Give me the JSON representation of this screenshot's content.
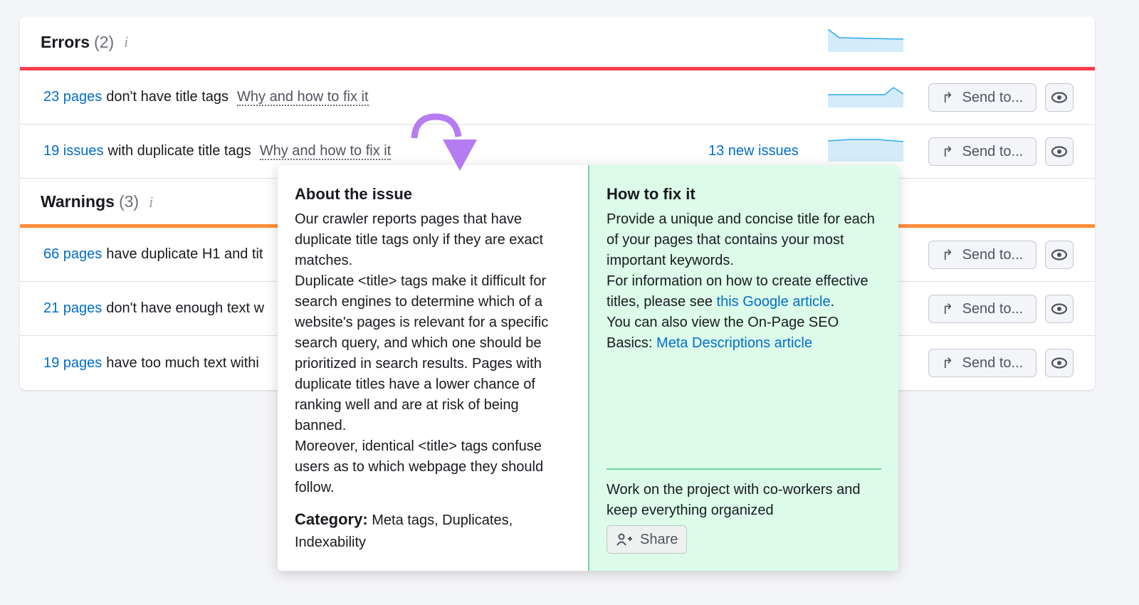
{
  "errors": {
    "title": "Errors",
    "count": "(2)",
    "info": "i",
    "color": "#ff3d4d"
  },
  "warnings": {
    "title": "Warnings",
    "count": "(3)",
    "info": "i",
    "color": "#ff8c39"
  },
  "send_label": "Send to...",
  "rows": [
    {
      "link": "23 pages",
      "text": "don't have title tags",
      "why": "Why and how to fix it",
      "spark": [
        4,
        1.5,
        1.6,
        1.5,
        1.5,
        1.4
      ]
    },
    {
      "link": "19 issues",
      "text": "with duplicate title tags",
      "why": "Why and how to fix it",
      "new": "13 new issues",
      "spark": [
        1.5,
        1.5,
        1.5,
        1.5,
        2.8,
        1.5
      ]
    },
    {
      "link": "66 pages",
      "text": "have duplicate H1 and tit"
    },
    {
      "link": "21 pages",
      "text": "don't have enough text w"
    },
    {
      "link": "19 pages",
      "text": "have too much text withi"
    }
  ],
  "popup": {
    "about_title": "About the issue",
    "about_paras": [
      "Our crawler reports pages that have duplicate title tags only if they are exact matches.",
      "Duplicate <title> tags make it difficult for search engines to determine which of a website's pages is relevant for a specific search query, and which one should be prioritized in search results. Pages with duplicate titles have a lower chance of ranking well and are at risk of being banned.",
      "Moreover, identical <title> tags confuse users as to which webpage they should follow."
    ],
    "category_label": "Category:",
    "category_value": "Meta tags, Duplicates, Indexability",
    "fix_title": "How to fix it",
    "fix_p1": "Provide a unique and concise title for each of your pages that contains your most important keywords.",
    "fix_p2_pre": "For information on how to create effective titles, please see ",
    "fix_p2_link": "this Google article",
    "fix_p2_post": ".",
    "fix_p3_pre": "You can also view the On-Page SEO Basics: ",
    "fix_p3_link": "Meta Descriptions article",
    "footer_text": "Work on the project with co-workers and keep everything organized",
    "share_label": "Share"
  }
}
